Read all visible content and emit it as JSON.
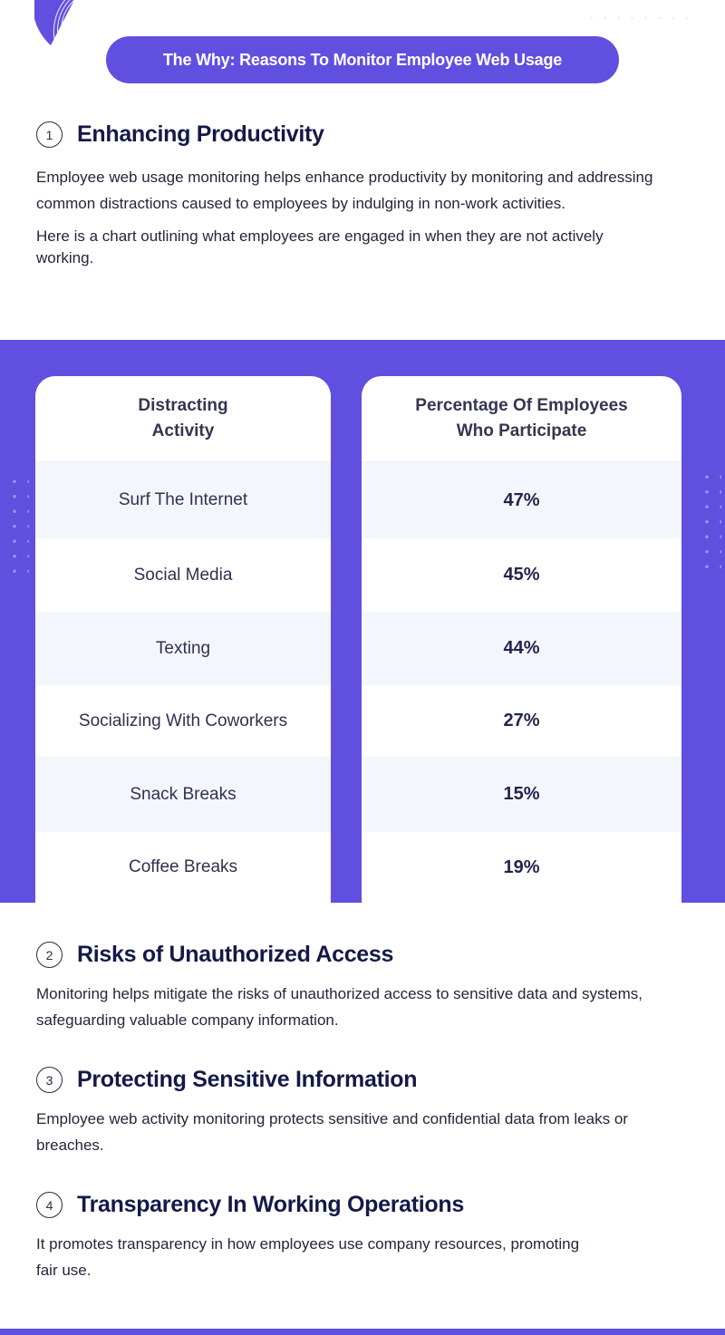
{
  "banner": {
    "title": "The Why: Reasons To Monitor Employee Web Usage"
  },
  "sections": [
    {
      "number": "1",
      "title": "Enhancing Productivity",
      "paragraphs": [
        "Employee web usage monitoring helps enhance productivity by monitoring and addressing common distractions caused to employees by indulging in non-work activities.",
        "Here is a chart outlining what employees are engaged in when they are not actively working."
      ]
    },
    {
      "number": "2",
      "title": "Risks of Unauthorized Access",
      "paragraphs": [
        "Monitoring helps mitigate the risks of unauthorized access to sensitive data and systems, safeguarding valuable company information."
      ]
    },
    {
      "number": "3",
      "title": "Protecting Sensitive Information",
      "paragraphs": [
        "Employee web activity monitoring protects sensitive and confidential data from leaks or breaches."
      ]
    },
    {
      "number": "4",
      "title": "Transparency In Working Operations",
      "paragraphs": [
        "It promotes transparency in how employees use company resources, promoting fair use."
      ]
    }
  ],
  "table": {
    "headers": [
      "Distracting Activity",
      "Percentage Of Employees Who Participate"
    ],
    "rows": [
      {
        "activity": "Surf The Internet",
        "percent": "47%"
      },
      {
        "activity": "Social Media",
        "percent": "45%"
      },
      {
        "activity": "Texting",
        "percent": "44%"
      },
      {
        "activity": "Socializing With Coworkers",
        "percent": "27%"
      },
      {
        "activity": "Snack Breaks",
        "percent": "15%"
      },
      {
        "activity": "Coffee Breaks",
        "percent": "19%"
      }
    ]
  },
  "colors": {
    "accent": "#614fe0",
    "heading": "#131a48",
    "row_alt": "#f4f6fd"
  }
}
